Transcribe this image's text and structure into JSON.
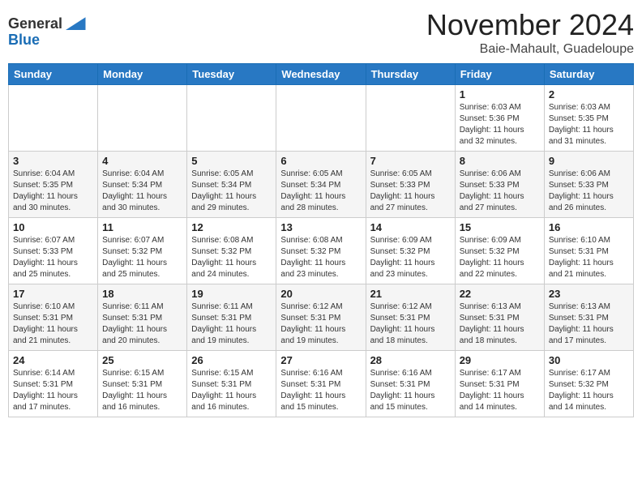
{
  "header": {
    "logo_line1": "General",
    "logo_line2": "Blue",
    "month": "November 2024",
    "location": "Baie-Mahault, Guadeloupe"
  },
  "weekdays": [
    "Sunday",
    "Monday",
    "Tuesday",
    "Wednesday",
    "Thursday",
    "Friday",
    "Saturday"
  ],
  "weeks": [
    [
      {
        "day": "",
        "info": ""
      },
      {
        "day": "",
        "info": ""
      },
      {
        "day": "",
        "info": ""
      },
      {
        "day": "",
        "info": ""
      },
      {
        "day": "",
        "info": ""
      },
      {
        "day": "1",
        "info": "Sunrise: 6:03 AM\nSunset: 5:36 PM\nDaylight: 11 hours\nand 32 minutes."
      },
      {
        "day": "2",
        "info": "Sunrise: 6:03 AM\nSunset: 5:35 PM\nDaylight: 11 hours\nand 31 minutes."
      }
    ],
    [
      {
        "day": "3",
        "info": "Sunrise: 6:04 AM\nSunset: 5:35 PM\nDaylight: 11 hours\nand 30 minutes."
      },
      {
        "day": "4",
        "info": "Sunrise: 6:04 AM\nSunset: 5:34 PM\nDaylight: 11 hours\nand 30 minutes."
      },
      {
        "day": "5",
        "info": "Sunrise: 6:05 AM\nSunset: 5:34 PM\nDaylight: 11 hours\nand 29 minutes."
      },
      {
        "day": "6",
        "info": "Sunrise: 6:05 AM\nSunset: 5:34 PM\nDaylight: 11 hours\nand 28 minutes."
      },
      {
        "day": "7",
        "info": "Sunrise: 6:05 AM\nSunset: 5:33 PM\nDaylight: 11 hours\nand 27 minutes."
      },
      {
        "day": "8",
        "info": "Sunrise: 6:06 AM\nSunset: 5:33 PM\nDaylight: 11 hours\nand 27 minutes."
      },
      {
        "day": "9",
        "info": "Sunrise: 6:06 AM\nSunset: 5:33 PM\nDaylight: 11 hours\nand 26 minutes."
      }
    ],
    [
      {
        "day": "10",
        "info": "Sunrise: 6:07 AM\nSunset: 5:33 PM\nDaylight: 11 hours\nand 25 minutes."
      },
      {
        "day": "11",
        "info": "Sunrise: 6:07 AM\nSunset: 5:32 PM\nDaylight: 11 hours\nand 25 minutes."
      },
      {
        "day": "12",
        "info": "Sunrise: 6:08 AM\nSunset: 5:32 PM\nDaylight: 11 hours\nand 24 minutes."
      },
      {
        "day": "13",
        "info": "Sunrise: 6:08 AM\nSunset: 5:32 PM\nDaylight: 11 hours\nand 23 minutes."
      },
      {
        "day": "14",
        "info": "Sunrise: 6:09 AM\nSunset: 5:32 PM\nDaylight: 11 hours\nand 23 minutes."
      },
      {
        "day": "15",
        "info": "Sunrise: 6:09 AM\nSunset: 5:32 PM\nDaylight: 11 hours\nand 22 minutes."
      },
      {
        "day": "16",
        "info": "Sunrise: 6:10 AM\nSunset: 5:31 PM\nDaylight: 11 hours\nand 21 minutes."
      }
    ],
    [
      {
        "day": "17",
        "info": "Sunrise: 6:10 AM\nSunset: 5:31 PM\nDaylight: 11 hours\nand 21 minutes."
      },
      {
        "day": "18",
        "info": "Sunrise: 6:11 AM\nSunset: 5:31 PM\nDaylight: 11 hours\nand 20 minutes."
      },
      {
        "day": "19",
        "info": "Sunrise: 6:11 AM\nSunset: 5:31 PM\nDaylight: 11 hours\nand 19 minutes."
      },
      {
        "day": "20",
        "info": "Sunrise: 6:12 AM\nSunset: 5:31 PM\nDaylight: 11 hours\nand 19 minutes."
      },
      {
        "day": "21",
        "info": "Sunrise: 6:12 AM\nSunset: 5:31 PM\nDaylight: 11 hours\nand 18 minutes."
      },
      {
        "day": "22",
        "info": "Sunrise: 6:13 AM\nSunset: 5:31 PM\nDaylight: 11 hours\nand 18 minutes."
      },
      {
        "day": "23",
        "info": "Sunrise: 6:13 AM\nSunset: 5:31 PM\nDaylight: 11 hours\nand 17 minutes."
      }
    ],
    [
      {
        "day": "24",
        "info": "Sunrise: 6:14 AM\nSunset: 5:31 PM\nDaylight: 11 hours\nand 17 minutes."
      },
      {
        "day": "25",
        "info": "Sunrise: 6:15 AM\nSunset: 5:31 PM\nDaylight: 11 hours\nand 16 minutes."
      },
      {
        "day": "26",
        "info": "Sunrise: 6:15 AM\nSunset: 5:31 PM\nDaylight: 11 hours\nand 16 minutes."
      },
      {
        "day": "27",
        "info": "Sunrise: 6:16 AM\nSunset: 5:31 PM\nDaylight: 11 hours\nand 15 minutes."
      },
      {
        "day": "28",
        "info": "Sunrise: 6:16 AM\nSunset: 5:31 PM\nDaylight: 11 hours\nand 15 minutes."
      },
      {
        "day": "29",
        "info": "Sunrise: 6:17 AM\nSunset: 5:31 PM\nDaylight: 11 hours\nand 14 minutes."
      },
      {
        "day": "30",
        "info": "Sunrise: 6:17 AM\nSunset: 5:32 PM\nDaylight: 11 hours\nand 14 minutes."
      }
    ]
  ]
}
